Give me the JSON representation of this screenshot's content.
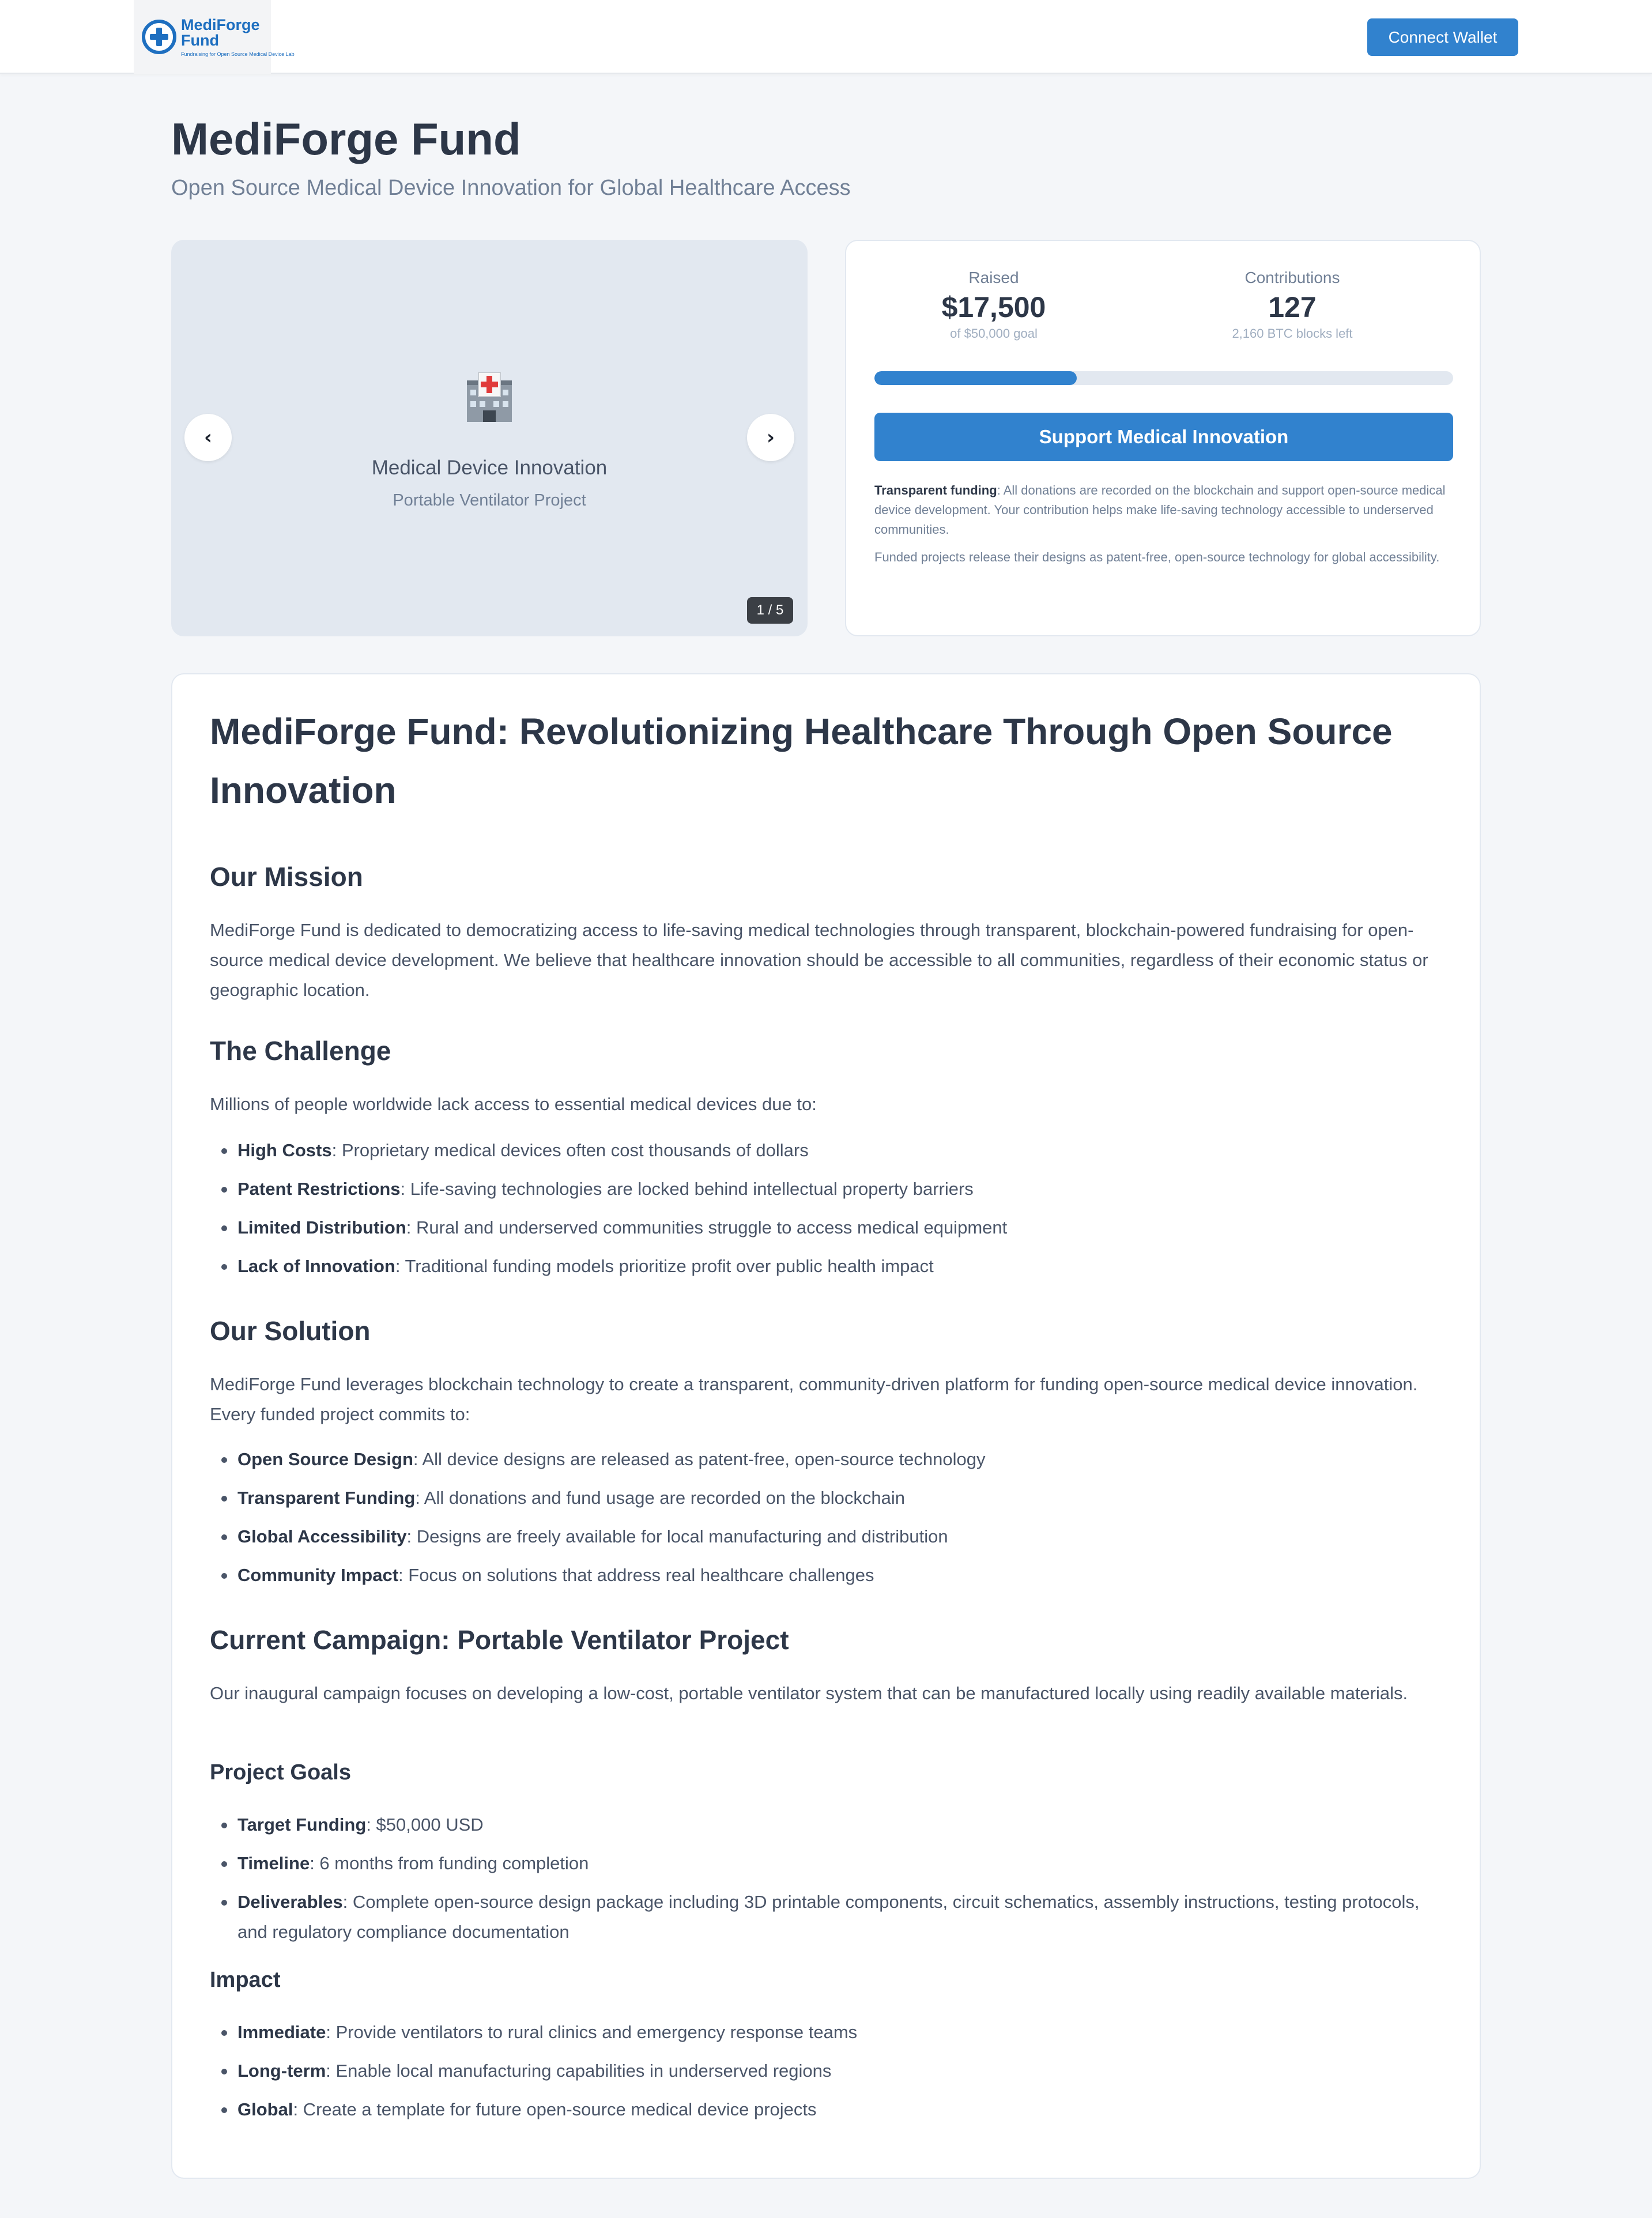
{
  "header": {
    "logo_name": "MediForge Fund",
    "logo_tagline": "Fundraising for Open Source Medical Device Lab",
    "connect_label": "Connect Wallet"
  },
  "hero": {
    "title": "MediForge Fund",
    "subtitle": "Open Source Medical Device Innovation for Global Healthcare Access"
  },
  "carousel": {
    "icon": "hospital-icon",
    "title": "Medical Device Innovation",
    "subtitle": "Portable Ventilator Project",
    "prev_label": "‹",
    "next_label": "›",
    "counter": "1 / 5"
  },
  "funding": {
    "raised_label": "Raised",
    "raised_value": "$17,500",
    "raised_note": "of $50,000 goal",
    "contrib_label": "Contributions",
    "contrib_value": "127",
    "contrib_note": "2,160 BTC blocks left",
    "progress_fraction": 0.35,
    "support_label": "Support Medical Innovation",
    "note_bold": "Transparent funding",
    "note_text": ": All donations are recorded on the blockchain and support open-source medical device development. Your contribution helps make life-saving technology accessible to underserved communities.",
    "note2": "Funded projects release their designs as patent-free, open-source technology for global accessibility."
  },
  "article": {
    "title": "MediForge Fund: Revolutionizing Healthcare Through Open Source Innovation",
    "mission_heading": "Our Mission",
    "mission_text": "MediForge Fund is dedicated to democratizing access to life-saving medical technologies through transparent, blockchain-powered fundraising for open-source medical device development. We believe that healthcare innovation should be accessible to all communities, regardless of their economic status or geographic location.",
    "challenge_heading": "The Challenge",
    "challenge_intro": "Millions of people worldwide lack access to essential medical devices due to:",
    "challenge_items": [
      {
        "bold": "High Costs",
        "text": ": Proprietary medical devices often cost thousands of dollars"
      },
      {
        "bold": "Patent Restrictions",
        "text": ": Life-saving technologies are locked behind intellectual property barriers"
      },
      {
        "bold": "Limited Distribution",
        "text": ": Rural and underserved communities struggle to access medical equipment"
      },
      {
        "bold": "Lack of Innovation",
        "text": ": Traditional funding models prioritize profit over public health impact"
      }
    ],
    "solution_heading": "Our Solution",
    "solution_intro": "MediForge Fund leverages blockchain technology to create a transparent, community-driven platform for funding open-source medical device innovation. Every funded project commits to:",
    "solution_items": [
      {
        "bold": "Open Source Design",
        "text": ": All device designs are released as patent-free, open-source technology"
      },
      {
        "bold": "Transparent Funding",
        "text": ": All donations and fund usage are recorded on the blockchain"
      },
      {
        "bold": "Global Accessibility",
        "text": ": Designs are freely available for local manufacturing and distribution"
      },
      {
        "bold": "Community Impact",
        "text": ": Focus on solutions that address real healthcare challenges"
      }
    ],
    "campaign_heading": "Current Campaign: Portable Ventilator Project",
    "campaign_intro": "Our inaugural campaign focuses on developing a low-cost, portable ventilator system that can be manufactured locally using readily available materials.",
    "goals_heading": "Project Goals",
    "goals_items": [
      {
        "bold": "Target Funding",
        "text": ": $50,000 USD"
      },
      {
        "bold": "Timeline",
        "text": ": 6 months from funding completion"
      },
      {
        "bold": "Deliverables",
        "text": ": Complete open-source design package including 3D printable components, circuit schematics, assembly instructions, testing protocols, and regulatory compliance documentation"
      }
    ],
    "impact_heading": "Impact",
    "impact_items": [
      {
        "bold": "Immediate",
        "text": ": Provide ventilators to rural clinics and emergency response teams"
      },
      {
        "bold": "Long-term",
        "text": ": Enable local manufacturing capabilities in underserved regions"
      },
      {
        "bold": "Global",
        "text": ": Create a template for future open-source medical device projects"
      }
    ]
  }
}
